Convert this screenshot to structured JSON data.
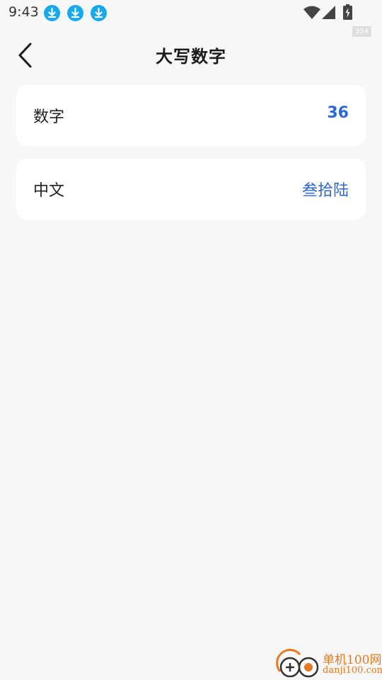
{
  "status_bar": {
    "time": "9:43",
    "notification_icons": [
      "download-icon",
      "download-icon",
      "download-icon"
    ],
    "accent_color": "#16a9f0",
    "badge": "334"
  },
  "header": {
    "title": "大写数字",
    "back_icon": "chevron-left-icon"
  },
  "rows": [
    {
      "label": "数字",
      "value": "36"
    },
    {
      "label": "中文",
      "value": "叁拾陆"
    }
  ],
  "colors": {
    "value": "#2a67d8",
    "background": "#f7f7f7",
    "card": "#ffffff"
  },
  "watermark": {
    "name": "单机100网",
    "url": "danji100.com"
  }
}
